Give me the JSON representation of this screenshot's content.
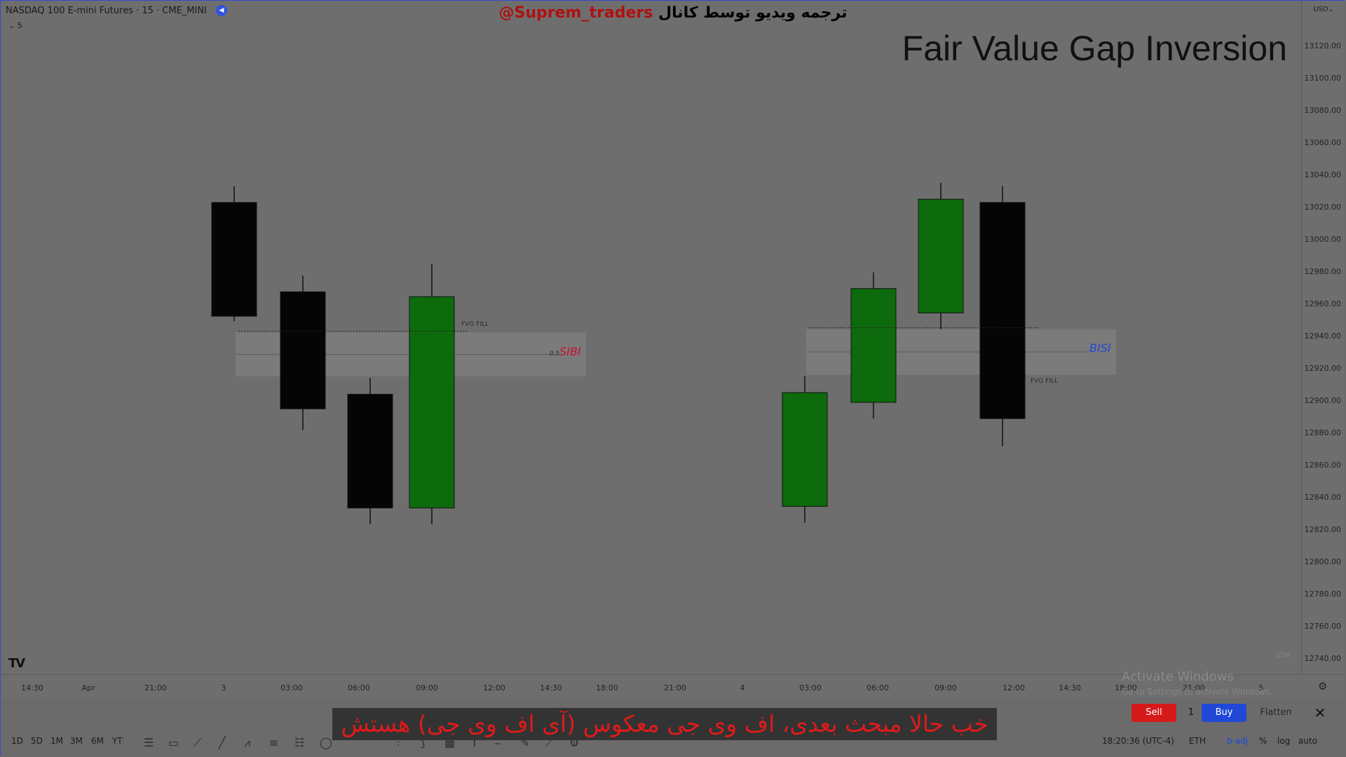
{
  "header": {
    "symbol": "NASDAQ 100 E-mini Futures · 15 · CME_MINI",
    "collapse_label": "⌄ 5",
    "credit_handle": "@Suprem_traders",
    "credit_text": "ترجمه ویدیو توسط کانال",
    "title": "Fair Value Gap Inversion"
  },
  "price_scale": {
    "currency": "USD⌄",
    "ticks": [
      "13120.00",
      "13100.00",
      "13080.00",
      "13060.00",
      "13040.00",
      "13020.00",
      "13000.00",
      "12980.00",
      "12960.00",
      "12940.00",
      "12920.00",
      "12900.00",
      "12880.00",
      "12860.00",
      "12840.00",
      "12820.00",
      "12800.00",
      "12780.00",
      "12760.00",
      "12740.00"
    ]
  },
  "time_axis": {
    "labels": [
      "14:30",
      "Apr",
      "21:00",
      "3",
      "03:00",
      "06:00",
      "09:00",
      "12:00",
      "14:30",
      "18:00",
      "21:00",
      "4",
      "03:00",
      "06:00",
      "09:00",
      "12:00",
      "14:30",
      "18:00",
      "21:00",
      "5"
    ]
  },
  "annotations": {
    "sibi": "SIBI",
    "bisi": "BISI",
    "fvg_fill_left": "FVG FILL",
    "fvg_fill_right": "FVG FILL",
    "mid_mark": "0.5"
  },
  "chart_data": {
    "type": "candlestick",
    "groups": [
      {
        "label": "SIBI",
        "candles": [
          {
            "open": 13020,
            "high": 13030,
            "low": 12947,
            "close": 12950,
            "color": "black"
          },
          {
            "open": 12965,
            "high": 12975,
            "low": 12880,
            "close": 12893,
            "color": "black"
          },
          {
            "open": 12902,
            "high": 12912,
            "low": 12822,
            "close": 12832,
            "color": "black"
          },
          {
            "open": 12832,
            "high": 12982,
            "low": 12822,
            "close": 12962,
            "color": "green"
          }
        ],
        "gap": {
          "top": 12940,
          "bottom": 12913
        }
      },
      {
        "label": "BISI",
        "candles": [
          {
            "open": 12833,
            "high": 12913,
            "low": 12823,
            "close": 12903,
            "color": "green"
          },
          {
            "open": 12897,
            "high": 12977,
            "low": 12887,
            "close": 12967,
            "color": "green"
          },
          {
            "open": 12952,
            "high": 13032,
            "low": 12942,
            "close": 13022,
            "color": "green"
          },
          {
            "open": 13020,
            "high": 13030,
            "low": 12870,
            "close": 12887,
            "color": "black"
          }
        ],
        "gap": {
          "top": 12942,
          "bottom": 12914
        }
      }
    ],
    "ylim": [
      12740,
      13120
    ]
  },
  "watermark": {
    "line1": "Activate Windows",
    "line2": "Go to Settings to activate Windows."
  },
  "interval_mark": "15M",
  "trade": {
    "sell_label": "Sell",
    "qty": "1",
    "buy_label": "Buy",
    "flatten_label": "Flatten",
    "close_icon": "✕"
  },
  "bottom": {
    "timeframes": [
      "1D",
      "5D",
      "1M",
      "3M",
      "6M",
      "YTD"
    ],
    "clock": "18:20:36 (UTC-4)",
    "session": "ETH",
    "adj": "b-adj",
    "percent": "%",
    "log": "log",
    "auto": "auto"
  },
  "subtitle": "خب حالا مبحث بعدی، اف وی جی معکوس (آی اف وی جی)  هستش"
}
